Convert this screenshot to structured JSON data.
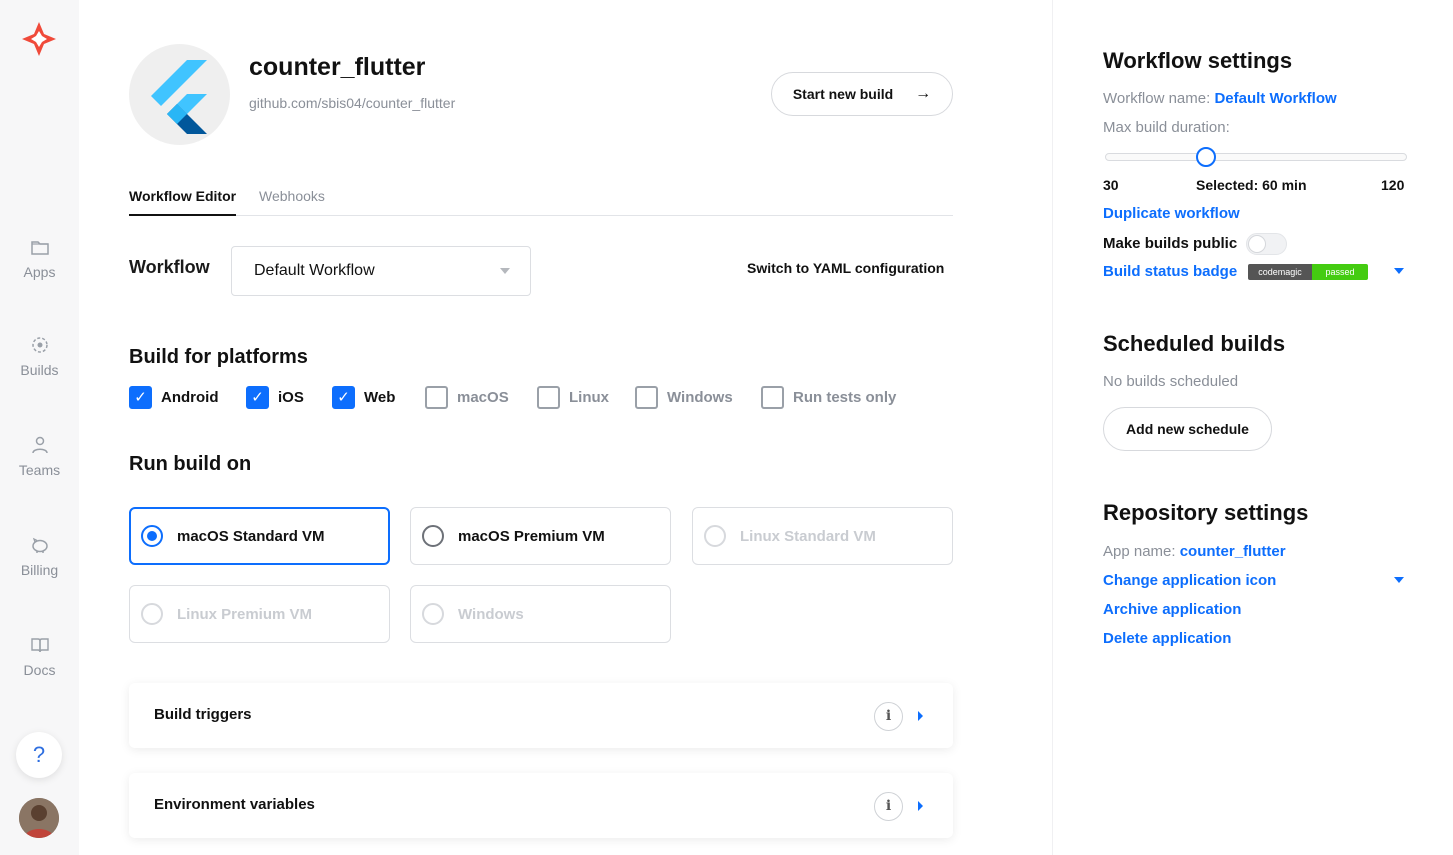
{
  "nav": {
    "items": [
      {
        "label": "Apps",
        "icon": "folder-icon"
      },
      {
        "label": "Builds",
        "icon": "builds-icon"
      },
      {
        "label": "Teams",
        "icon": "person-icon"
      },
      {
        "label": "Billing",
        "icon": "piggy-bank-icon"
      },
      {
        "label": "Docs",
        "icon": "book-icon"
      }
    ],
    "help_label": "?"
  },
  "app": {
    "title": "counter_flutter",
    "repo": "github.com/sbis04/counter_flutter",
    "start_build_label": "Start new build",
    "start_build_icon": "→"
  },
  "tabs": [
    {
      "label": "Workflow Editor",
      "active": true
    },
    {
      "label": "Webhooks",
      "active": false
    }
  ],
  "workflow": {
    "label": "Workflow",
    "selected": "Default Workflow",
    "yaml_link": "Switch to YAML configuration"
  },
  "platforms": {
    "heading": "Build for platforms",
    "items": [
      {
        "label": "Android",
        "checked": true
      },
      {
        "label": "iOS",
        "checked": true
      },
      {
        "label": "Web",
        "checked": true
      },
      {
        "label": "macOS",
        "checked": false
      },
      {
        "label": "Linux",
        "checked": false
      },
      {
        "label": "Windows",
        "checked": false
      },
      {
        "label": "Run tests only",
        "checked": false
      }
    ]
  },
  "run_on": {
    "heading": "Run build on",
    "options": [
      {
        "label": "macOS Standard VM",
        "state": "selected"
      },
      {
        "label": "macOS Premium VM",
        "state": "enabled"
      },
      {
        "label": "Linux Standard VM",
        "state": "disabled"
      },
      {
        "label": "Linux Premium VM",
        "state": "disabled"
      },
      {
        "label": "Windows",
        "state": "disabled"
      }
    ]
  },
  "sections": [
    {
      "label": "Build triggers"
    },
    {
      "label": "Environment variables"
    }
  ],
  "side": {
    "workflow_settings": {
      "heading": "Workflow settings",
      "name_label": "Workflow name:",
      "name_value": "Default Workflow",
      "duration_label": "Max build duration:",
      "min": "30",
      "max": "120",
      "selected_label": "Selected: 60 min",
      "slider_fraction": 0.333,
      "duplicate": "Duplicate workflow",
      "public_label": "Make builds public",
      "public_on": false,
      "badge_link": "Build status badge",
      "badge_left": "codemagic",
      "badge_right": "passed"
    },
    "scheduled": {
      "heading": "Scheduled builds",
      "empty": "No builds scheduled",
      "add_label": "Add new schedule"
    },
    "repo": {
      "heading": "Repository settings",
      "app_name_label": "App name:",
      "app_name_value": "counter_flutter",
      "change_icon": "Change application icon",
      "archive": "Archive application",
      "delete": "Delete application"
    }
  },
  "colors": {
    "accent": "#0d6efd",
    "badge_green": "#44cc11",
    "flutter_light": "#40c4ff",
    "flutter_dark": "#01579b"
  }
}
